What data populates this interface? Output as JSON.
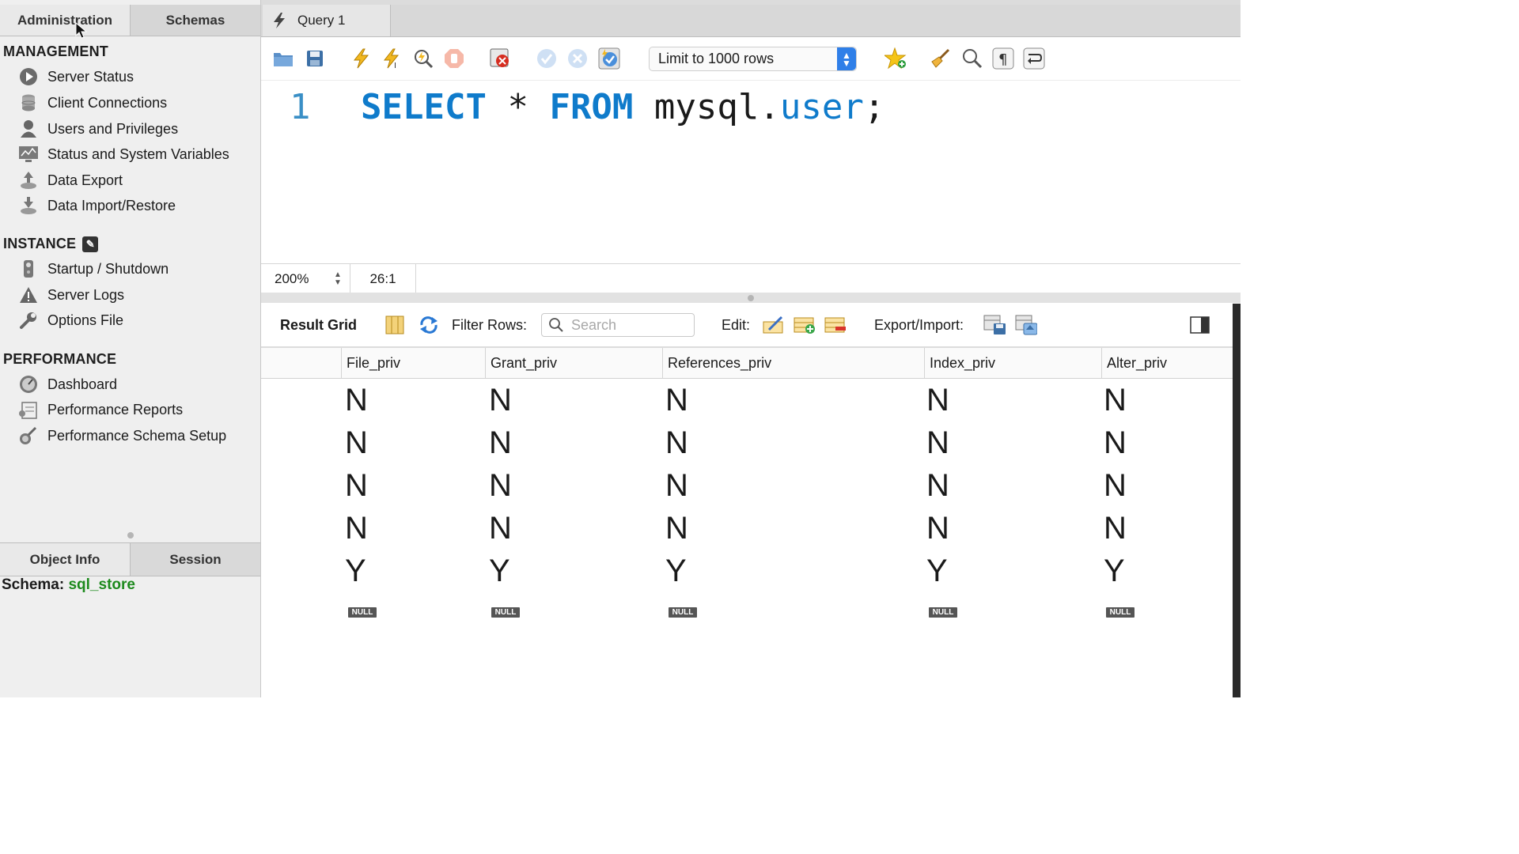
{
  "left_panel": {
    "tabs": [
      "Administration",
      "Schemas"
    ],
    "management": {
      "title": "MANAGEMENT",
      "items": [
        "Server Status",
        "Client Connections",
        "Users and Privileges",
        "Status and System Variables",
        "Data Export",
        "Data Import/Restore"
      ]
    },
    "instance": {
      "title": "INSTANCE",
      "items": [
        "Startup / Shutdown",
        "Server Logs",
        "Options File"
      ]
    },
    "performance": {
      "title": "PERFORMANCE",
      "items": [
        "Dashboard",
        "Performance Reports",
        "Performance Schema Setup"
      ]
    },
    "bottom_tabs": [
      "Object Info",
      "Session"
    ],
    "schema_label": "Schema:",
    "schema_value": "sql_store"
  },
  "query_tab": {
    "label": "Query 1"
  },
  "toolbar": {
    "limit_label": "Limit to 1000 rows",
    "icons": [
      "open-folder-icon",
      "save-icon",
      "execute-icon",
      "execute-current-icon",
      "explain-icon",
      "stop-icon",
      "toggle-error-icon",
      "commit-icon",
      "rollback-icon",
      "autocommit-icon",
      "bookmark-icon",
      "beautify-icon",
      "find-icon",
      "invisible-chars-icon",
      "wrap-icon"
    ]
  },
  "editor": {
    "line_number": "1",
    "tokens": {
      "select": "SELECT",
      "star": "*",
      "from": "FROM",
      "schema": "mysql",
      "dot": ".",
      "table": "user",
      "semicolon": ";"
    }
  },
  "statusbar": {
    "zoom": "200%",
    "position": "26:1"
  },
  "result_toolbar": {
    "title": "Result Grid",
    "filter_label": "Filter Rows:",
    "search_placeholder": "Search",
    "edit_label": "Edit:",
    "export_label": "Export/Import:"
  },
  "grid": {
    "columns": [
      "File_priv",
      "Grant_priv",
      "References_priv",
      "Index_priv",
      "Alter_priv"
    ],
    "rows": [
      [
        "N",
        "N",
        "N",
        "N",
        "N"
      ],
      [
        "N",
        "N",
        "N",
        "N",
        "N"
      ],
      [
        "N",
        "N",
        "N",
        "N",
        "N"
      ],
      [
        "N",
        "N",
        "N",
        "N",
        "N"
      ],
      [
        "Y",
        "Y",
        "Y",
        "Y",
        "Y"
      ],
      [
        "NULL",
        "NULL",
        "NULL",
        "NULL",
        "NULL"
      ]
    ]
  },
  "colors": {
    "keyword": "#0f7bcb",
    "schema_value": "#1d8a1d",
    "limit_arrow": "#2f7fe8"
  }
}
